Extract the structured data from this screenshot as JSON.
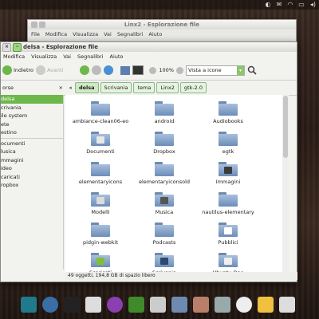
{
  "back_window": {
    "title": "Linx2 - Esplorazione file",
    "menu": [
      "File",
      "Modifica",
      "Visualizza",
      "Vai",
      "Segnalibri",
      "Aiuto"
    ]
  },
  "window": {
    "title": "delsa - Esplorazione file",
    "menu": [
      "Modifica",
      "Visualizza",
      "Vai",
      "Segnalibri",
      "Aiuto"
    ],
    "menu_first_partial": "",
    "back_label": "Indietro",
    "forward_label": "Avanti",
    "zoom": "100%",
    "view_mode": "Vista a icone",
    "sidebar_header": "orse",
    "breadcrumbs": [
      "delsa",
      "Scrivania",
      "tema",
      "Linx2",
      "gtk-2.0"
    ],
    "sidebar": [
      "delsa",
      "crivania",
      "ile system",
      "ete",
      "estino",
      "ocumenti",
      "lusica",
      "mmagini",
      "ideo",
      "caricati",
      "ropbox"
    ],
    "status": "49 oggetti, 194,8 GB di spazio libero"
  },
  "files": [
    {
      "name": "ambiance-clean06-eo",
      "icon": "folder"
    },
    {
      "name": "android",
      "icon": "folder"
    },
    {
      "name": "Audiobooks",
      "icon": "folder"
    },
    {
      "name": "Documenti",
      "icon": "folder-documents"
    },
    {
      "name": "Dropbox",
      "icon": "folder"
    },
    {
      "name": "egtk",
      "icon": "folder"
    },
    {
      "name": "elementaryicons",
      "icon": "folder"
    },
    {
      "name": "elementaryiconsold",
      "icon": "folder"
    },
    {
      "name": "Immagini",
      "icon": "folder-pictures"
    },
    {
      "name": "Modelli",
      "icon": "folder-templates"
    },
    {
      "name": "Musica",
      "icon": "folder-music"
    },
    {
      "name": "nautilus-elementary",
      "icon": "folder"
    },
    {
      "name": "pidgin-webkit",
      "icon": "folder"
    },
    {
      "name": "Podcasts",
      "icon": "folder"
    },
    {
      "name": "Pubblici",
      "icon": "folder-public"
    },
    {
      "name": "Scaricati",
      "icon": "folder-download"
    },
    {
      "name": "Scrivania",
      "icon": "folder-desktop"
    },
    {
      "name": "Ubuntu One",
      "icon": "folder-ubuntuone"
    }
  ],
  "colors": {
    "accent": "#6eb84b",
    "folder": "#8aa6cc"
  }
}
